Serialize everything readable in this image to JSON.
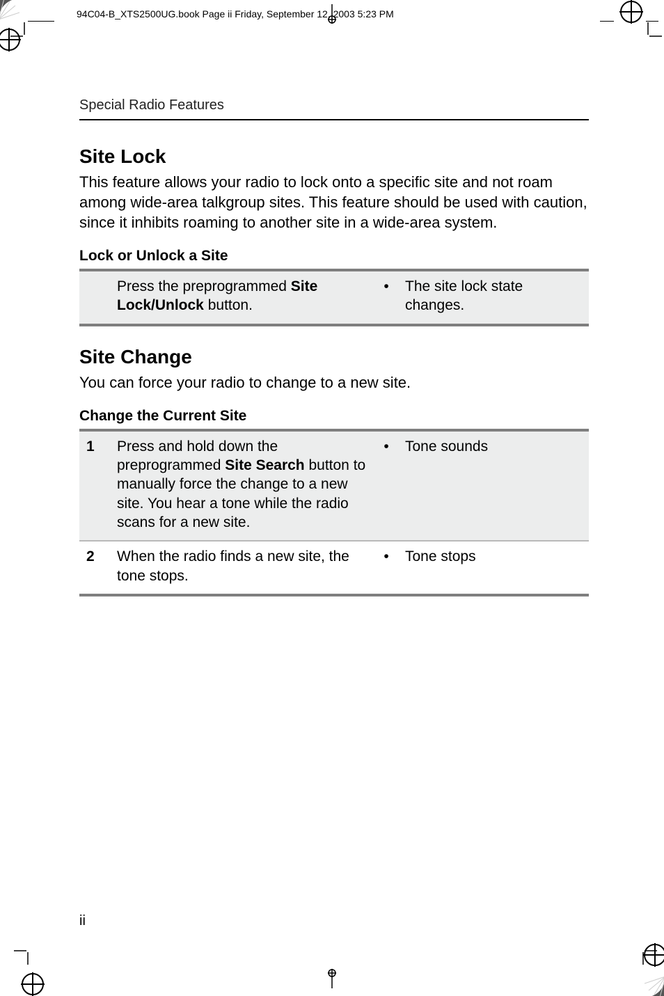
{
  "header_line": "94C04-B_XTS2500UG.book  Page ii  Friday, September 12, 2003  5:23 PM",
  "running_head": "Special Radio Features",
  "sections": {
    "site_lock": {
      "title": "Site Lock",
      "body": "This feature allows your radio to lock onto a specific site and not roam among wide-area talkgroup sites. This feature should be used with caution, since it inhibits roaming to another site in a wide-area system.",
      "subhead": "Lock or Unlock a Site",
      "rows": [
        {
          "num": "",
          "action_pre": "Press the preprogrammed ",
          "action_bold": "Site Lock/Unlock",
          "action_post": " button.",
          "result": "The site lock state changes."
        }
      ]
    },
    "site_change": {
      "title": "Site Change",
      "body": "You can force your radio to change to a new site.",
      "subhead": "Change the Current Site",
      "rows": [
        {
          "num": "1",
          "action_pre": "Press and hold down the preprogrammed ",
          "action_bold": "Site Search",
          "action_post": " button to manually force the change to a new site. You hear a tone while the radio scans for a new site.",
          "result": "Tone sounds"
        },
        {
          "num": "2",
          "action_pre": "When the radio finds a new site, the tone stops.",
          "action_bold": "",
          "action_post": "",
          "result": "Tone stops"
        }
      ]
    }
  },
  "page_number": "ii",
  "bullet": "•"
}
